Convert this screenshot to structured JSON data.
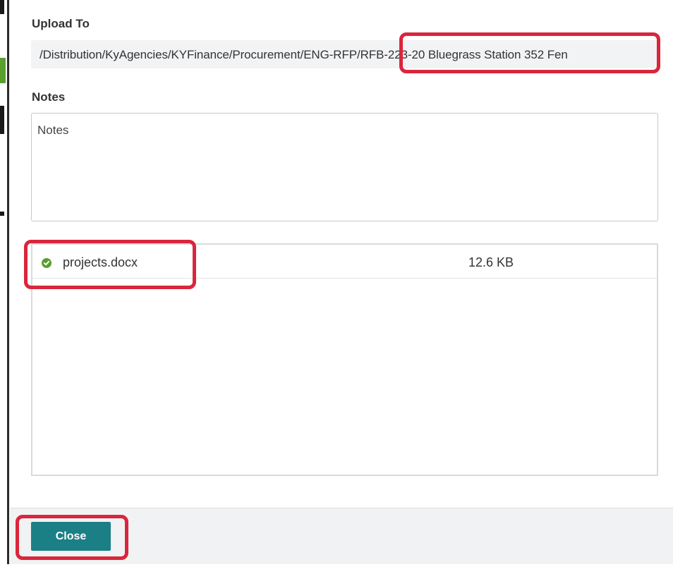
{
  "upload_to": {
    "label": "Upload To",
    "path": "/Distribution/KyAgencies/KYFinance/Procurement/ENG-RFP/RFB-223-20 Bluegrass Station 352 Fen"
  },
  "notes": {
    "label": "Notes",
    "placeholder": "Notes",
    "value": ""
  },
  "files": [
    {
      "name": "projects.docx",
      "size": "12.6 KB",
      "status_icon": "check-circle-icon"
    }
  ],
  "footer": {
    "close_label": "Close"
  },
  "colors": {
    "accent": "#1b7f86",
    "success": "#5b9e2f",
    "highlight": "#d9263c"
  }
}
